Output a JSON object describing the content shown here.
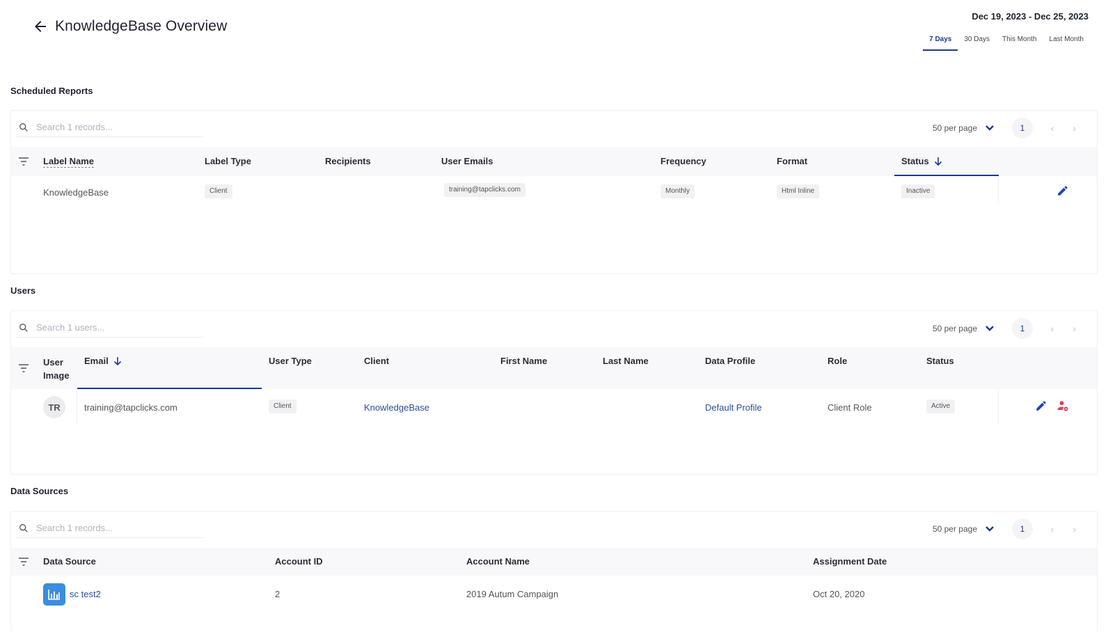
{
  "header": {
    "title": "KnowledgeBase Overview",
    "date_range": "Dec 19, 2023 - Dec 25, 2023",
    "range_tabs": [
      {
        "label": "7 Days",
        "active": true
      },
      {
        "label": "30 Days",
        "active": false
      },
      {
        "label": "This Month",
        "active": false
      },
      {
        "label": "Last Month",
        "active": false
      }
    ]
  },
  "scheduled_reports": {
    "title": "Scheduled Reports",
    "search_placeholder": "Search 1 records...",
    "per_page": "50 per page",
    "page": "1",
    "columns": [
      "Label Name",
      "Label Type",
      "Recipients",
      "User Emails",
      "Frequency",
      "Format",
      "Status"
    ],
    "rows": [
      {
        "label_name": "KnowledgeBase",
        "label_type": "Client",
        "recipients": "",
        "user_emails": "training@tapclicks.com",
        "frequency": "Monthly",
        "format": "Html Inline",
        "status": "Inactive"
      }
    ]
  },
  "users": {
    "title": "Users",
    "search_placeholder": "Search 1 users...",
    "per_page": "50 per page",
    "page": "1",
    "columns": [
      "User Image",
      "Email",
      "User Type",
      "Client",
      "First Name",
      "Last Name",
      "Data Profile",
      "Role",
      "Status"
    ],
    "rows": [
      {
        "initials": "TR",
        "email": "training@tapclicks.com",
        "user_type": "Client",
        "client": "KnowledgeBase",
        "first_name": "",
        "last_name": "",
        "data_profile": "Default Profile",
        "role": "Client Role",
        "status": "Active"
      }
    ]
  },
  "data_sources": {
    "title": "Data Sources",
    "search_placeholder": "Search 1 records...",
    "per_page": "50 per page",
    "page": "1",
    "columns": [
      "Data Source",
      "Account ID",
      "Account Name",
      "Assignment Date"
    ],
    "rows": [
      {
        "data_source": "sc test2",
        "account_id": "2",
        "account_name": "2019 Autum Campaign",
        "assignment_date": "Oct 20, 2020"
      }
    ]
  },
  "colors": {
    "accent": "#1b3a8c",
    "link": "#2a4da0",
    "danger": "#e0405e",
    "ds_icon": "#3a8ede"
  }
}
